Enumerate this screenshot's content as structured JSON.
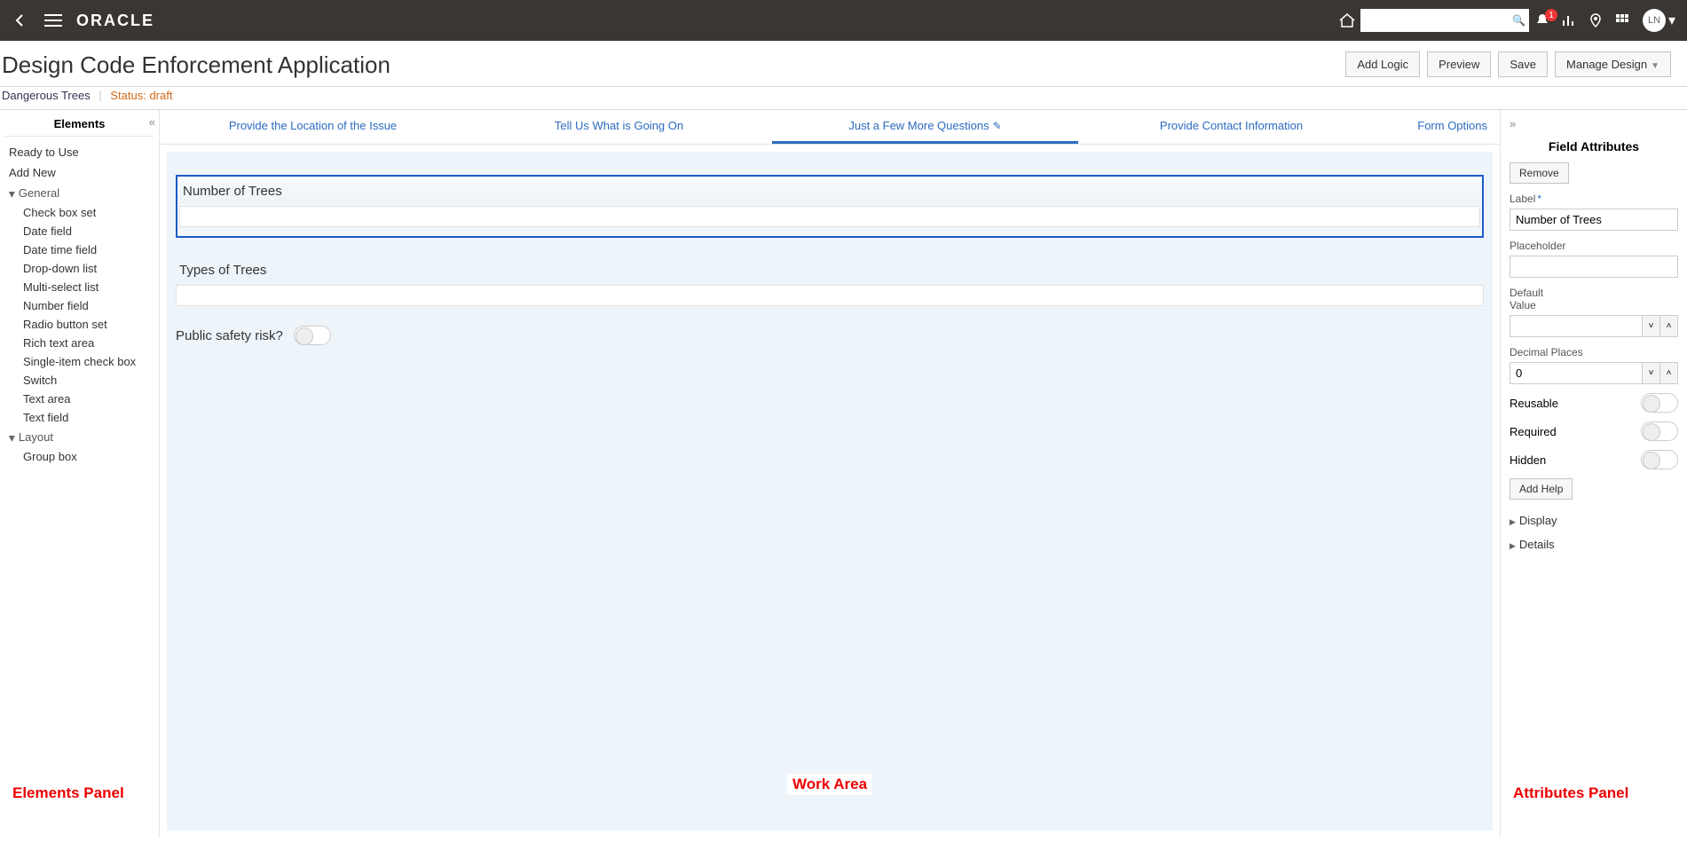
{
  "topbar": {
    "brand": "ORACLE",
    "search_placeholder": "",
    "notif_count": "1",
    "avatar_initials": "LN"
  },
  "header": {
    "title": "Design Code Enforcement Application",
    "actions": {
      "add_logic": "Add Logic",
      "preview": "Preview",
      "save": "Save",
      "manage": "Manage Design"
    }
  },
  "crumbs": {
    "name": "Dangerous Trees",
    "status": "Status: draft"
  },
  "elements": {
    "title": "Elements",
    "ready": "Ready to Use",
    "addnew": "Add New",
    "general_label": "General",
    "general": [
      "Check box set",
      "Date field",
      "Date time field",
      "Drop-down list",
      "Multi-select list",
      "Number field",
      "Radio button set",
      "Rich text area",
      "Single-item check box",
      "Switch",
      "Text area",
      "Text field"
    ],
    "layout_label": "Layout",
    "layout": [
      "Group box"
    ],
    "annot": "Elements Panel"
  },
  "tabs": {
    "t1": "Provide the Location of the Issue",
    "t2": "Tell Us What is Going On",
    "t3": "Just a Few More Questions",
    "t4": "Provide Contact Information",
    "formopt": "Form Options"
  },
  "fields": {
    "f1": "Number of Trees",
    "f2": "Types of Trees",
    "f3": "Public safety risk?"
  },
  "center_annot": "Work Area",
  "attrs": {
    "title": "Field Attributes",
    "remove": "Remove",
    "label_label": "Label",
    "label_value": "Number of Trees",
    "placeholder_label": "Placeholder",
    "placeholder_value": "",
    "default_label": "Default\nValue",
    "default_value": "",
    "decimal_label": "Decimal Places",
    "decimal_value": "0",
    "reusable": "Reusable",
    "required": "Required",
    "hidden": "Hidden",
    "addhelp": "Add Help",
    "display": "Display",
    "details": "Details",
    "annot": "Attributes Panel"
  }
}
